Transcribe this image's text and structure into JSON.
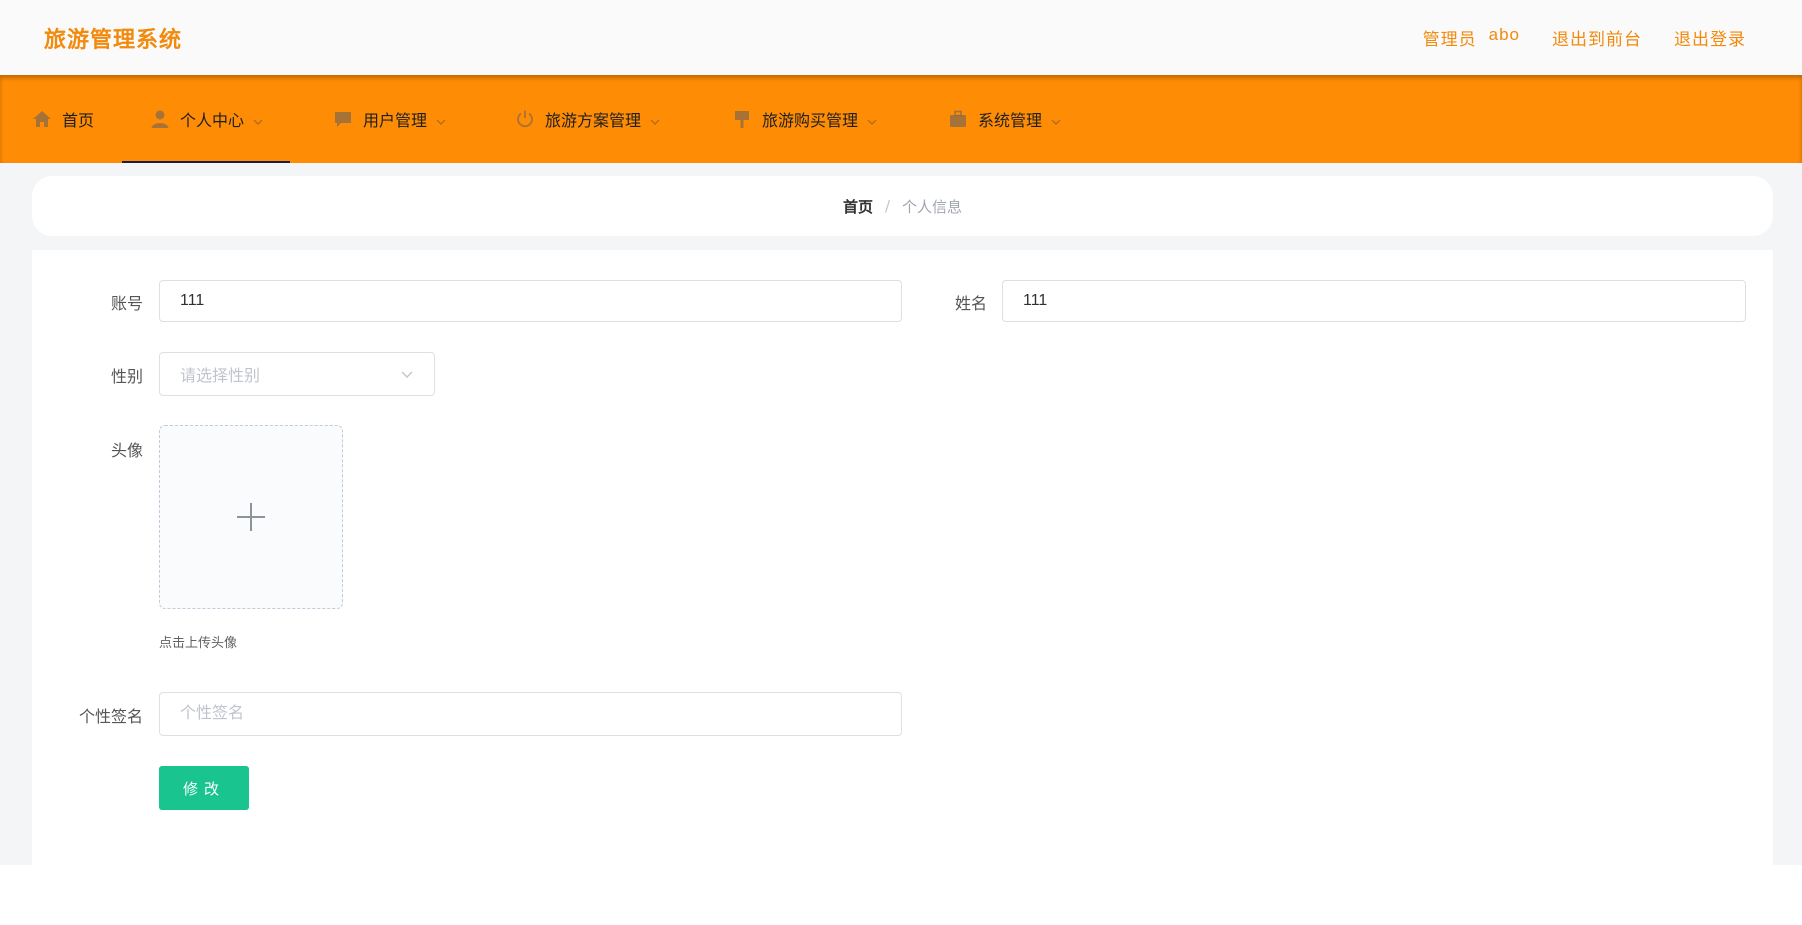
{
  "header": {
    "app_title": "旅游管理系统",
    "role_label": "管理员",
    "username": "abo",
    "to_frontend_label": "退出到前台",
    "logout_label": "退出登录"
  },
  "nav": {
    "items": [
      {
        "label": "首页",
        "icon": "home-icon",
        "dropdown": false
      },
      {
        "label": "个人中心",
        "icon": "user-icon",
        "dropdown": true,
        "active": true
      },
      {
        "label": "用户管理",
        "icon": "chat-icon",
        "dropdown": true
      },
      {
        "label": "旅游方案管理",
        "icon": "power-icon",
        "dropdown": true
      },
      {
        "label": "旅游购买管理",
        "icon": "flag-icon",
        "dropdown": true
      },
      {
        "label": "系统管理",
        "icon": "briefcase-icon",
        "dropdown": true
      }
    ]
  },
  "breadcrumb": {
    "home": "首页",
    "separator": "/",
    "current": "个人信息"
  },
  "form": {
    "account_label": "账号",
    "account_value": "111",
    "name_label": "姓名",
    "name_value": "111",
    "gender_label": "性别",
    "gender_placeholder": "请选择性别",
    "avatar_label": "头像",
    "avatar_tip": "点击上传头像",
    "signature_label": "个性签名",
    "signature_placeholder": "个性签名",
    "submit_label": "修改"
  },
  "colors": {
    "brand_orange": "#ff8c05",
    "header_text_orange": "#f28a0e",
    "submit_green": "#19c48f",
    "active_underline": "#1b1e3a"
  }
}
